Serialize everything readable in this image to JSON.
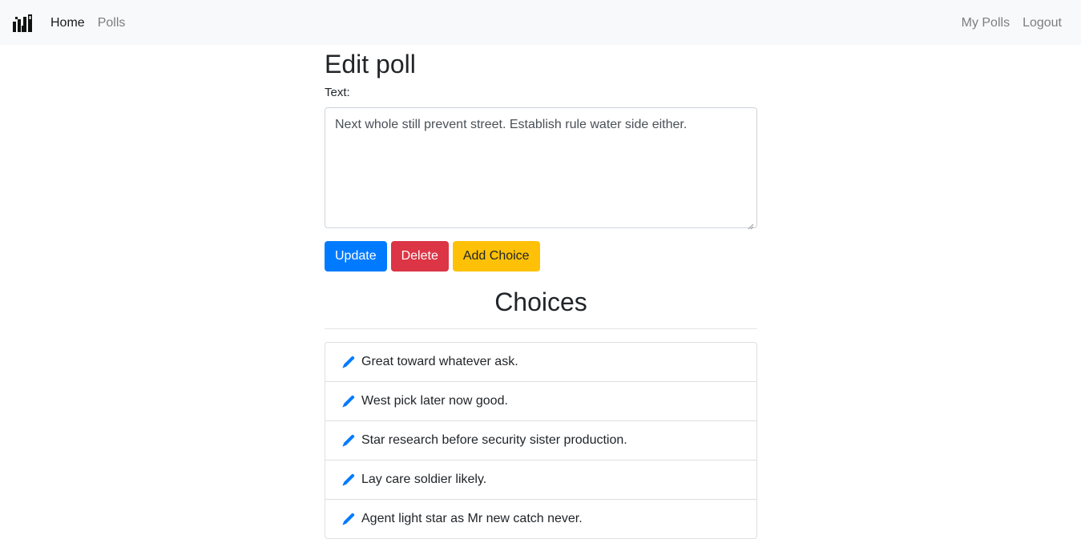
{
  "nav": {
    "brand_icon": "chart-bars-logo-icon",
    "links_left": [
      {
        "label": "Home",
        "active": true
      },
      {
        "label": "Polls",
        "active": false
      }
    ],
    "links_right": [
      {
        "label": "My Polls"
      },
      {
        "label": "Logout"
      }
    ]
  },
  "page": {
    "title": "Edit poll",
    "text_label": "Text:",
    "text_value": "Next whole still prevent street. Establish rule water side either."
  },
  "buttons": {
    "update": "Update",
    "delete": "Delete",
    "add_choice": "Add Choice"
  },
  "choices": {
    "title": "Choices",
    "edit_icon": "pencil-icon",
    "items": [
      {
        "text": "Great toward whatever ask."
      },
      {
        "text": "West pick later now good."
      },
      {
        "text": "Star research before security sister production."
      },
      {
        "text": "Lay care soldier likely."
      },
      {
        "text": "Agent light star as Mr new catch never."
      }
    ]
  },
  "colors": {
    "primary": "#007bff",
    "danger": "#dc3545",
    "warning": "#ffc107",
    "navbar_bg": "#f8f9fa",
    "pencil": "#007bff"
  }
}
